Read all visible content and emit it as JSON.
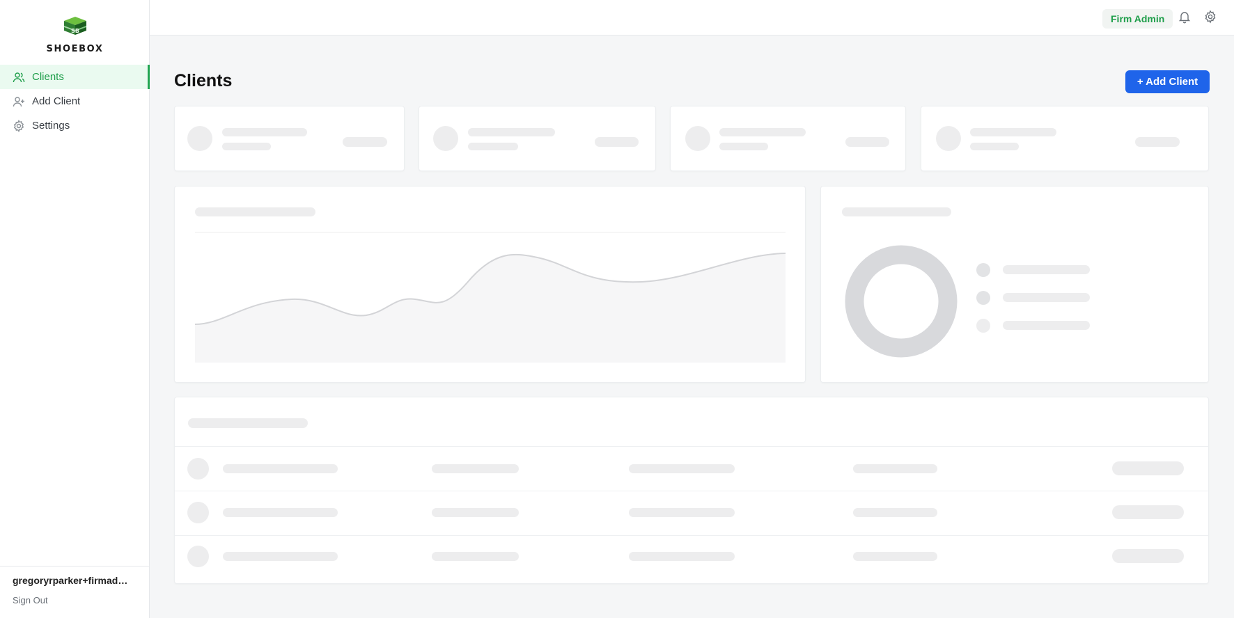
{
  "app": {
    "name": "SHOEBOX",
    "logo_letters": "SB"
  },
  "sidebar": {
    "items": [
      {
        "label": "Clients",
        "icon": "users-icon",
        "active": true
      },
      {
        "label": "Add Client",
        "icon": "user-plus-icon",
        "active": false
      },
      {
        "label": "Settings",
        "icon": "gear-icon",
        "active": false
      }
    ],
    "user_email": "gregoryrparker+firmadmi...",
    "sign_out_label": "Sign Out"
  },
  "header": {
    "role_badge": "Firm Admin",
    "icons": [
      "bell-icon",
      "gear-icon"
    ]
  },
  "main": {
    "title": "Clients",
    "add_button_label": "+ Add Client"
  },
  "colors": {
    "brand_green": "#22a552",
    "primary_blue": "#1f64ea",
    "skeleton": "#ededee"
  },
  "state": {
    "loading": true
  }
}
